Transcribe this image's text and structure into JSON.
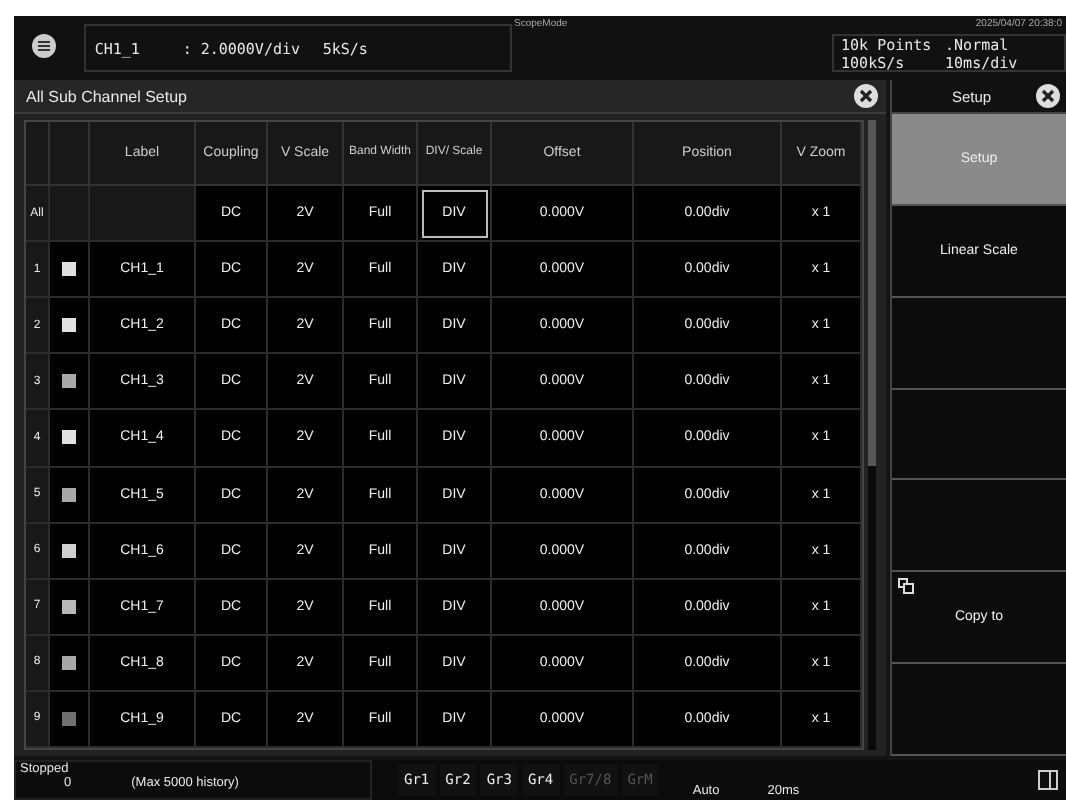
{
  "header": {
    "mode_title": "ScopeMode",
    "datetime": "2025/04/07 20:38:0",
    "channel_info": {
      "channel": "CH1_1",
      "scale": ": 2.0000V/div",
      "rate": "5kS/s"
    },
    "acquisition": {
      "points": "10k Points",
      "mode": ".Normal",
      "sample_rate": "100kS/s",
      "time_div": "10ms/div"
    }
  },
  "dialog": {
    "title": "All Sub Channel Setup",
    "columns": [
      "",
      "",
      "Label",
      "Coupling",
      "V Scale",
      "Band Width",
      "DIV/ Scale",
      "Offset",
      "Position",
      "V Zoom"
    ],
    "all_row": {
      "index": "All",
      "cells": [
        {
          "text": "DC",
          "selected": false
        },
        {
          "text": "2V",
          "selected": false
        },
        {
          "text": "Full",
          "selected": false
        },
        {
          "text": "DIV",
          "selected": true
        },
        {
          "text": "0.000V",
          "selected": false
        },
        {
          "text": "0.00div",
          "selected": false
        },
        {
          "text": "x 1",
          "selected": false
        }
      ]
    },
    "rows": [
      {
        "index": "1",
        "color": "#e0e0e0",
        "label": "CH1_1",
        "coupling": "DC",
        "v_scale": "2V",
        "band_width": "Full",
        "div_scale": "DIV",
        "offset": "0.000V",
        "position": "0.00div",
        "v_zoom": "x 1"
      },
      {
        "index": "2",
        "color": "#e0e0e0",
        "label": "CH1_2",
        "coupling": "DC",
        "v_scale": "2V",
        "band_width": "Full",
        "div_scale": "DIV",
        "offset": "0.000V",
        "position": "0.00div",
        "v_zoom": "x 1"
      },
      {
        "index": "3",
        "color": "#a8a8a8",
        "label": "CH1_3",
        "coupling": "DC",
        "v_scale": "2V",
        "band_width": "Full",
        "div_scale": "DIV",
        "offset": "0.000V",
        "position": "0.00div",
        "v_zoom": "x 1"
      },
      {
        "index": "4",
        "color": "#e0e0e0",
        "label": "CH1_4",
        "coupling": "DC",
        "v_scale": "2V",
        "band_width": "Full",
        "div_scale": "DIV",
        "offset": "0.000V",
        "position": "0.00div",
        "v_zoom": "x 1"
      },
      {
        "index": "5",
        "color": "#a8a8a8",
        "label": "CH1_5",
        "coupling": "DC",
        "v_scale": "2V",
        "band_width": "Full",
        "div_scale": "DIV",
        "offset": "0.000V",
        "position": "0.00div",
        "v_zoom": "x 1"
      },
      {
        "index": "6",
        "color": "#d0d0d0",
        "label": "CH1_6",
        "coupling": "DC",
        "v_scale": "2V",
        "band_width": "Full",
        "div_scale": "DIV",
        "offset": "0.000V",
        "position": "0.00div",
        "v_zoom": "x 1"
      },
      {
        "index": "7",
        "color": "#b8b8b8",
        "label": "CH1_7",
        "coupling": "DC",
        "v_scale": "2V",
        "band_width": "Full",
        "div_scale": "DIV",
        "offset": "0.000V",
        "position": "0.00div",
        "v_zoom": "x 1"
      },
      {
        "index": "8",
        "color": "#a8a8a8",
        "label": "CH1_8",
        "coupling": "DC",
        "v_scale": "2V",
        "band_width": "Full",
        "div_scale": "DIV",
        "offset": "0.000V",
        "position": "0.00div",
        "v_zoom": "x 1"
      },
      {
        "index": "9",
        "color": "#707070",
        "label": "CH1_9",
        "coupling": "DC",
        "v_scale": "2V",
        "band_width": "Full",
        "div_scale": "DIV",
        "offset": "0.000V",
        "position": "0.00div",
        "v_zoom": "x 1"
      }
    ]
  },
  "side_panel": {
    "title": "Setup",
    "items": [
      {
        "kind": "button",
        "label": "Setup",
        "selected": true
      },
      {
        "kind": "button",
        "label": "Linear Scale",
        "selected": false
      },
      {
        "kind": "blank"
      },
      {
        "kind": "blank"
      },
      {
        "kind": "blank"
      },
      {
        "kind": "copy",
        "label": "Copy to",
        "selected": false
      },
      {
        "kind": "blank"
      }
    ]
  },
  "status_bar": {
    "state": "Stopped",
    "count": "0",
    "history": "(Max 5000 history)",
    "groups": [
      {
        "label": "Gr1",
        "disabled": false
      },
      {
        "label": "Gr2",
        "disabled": false
      },
      {
        "label": "Gr3",
        "disabled": false
      },
      {
        "label": "Gr4",
        "disabled": false
      },
      {
        "label": "Gr7/8",
        "disabled": true
      },
      {
        "label": "GrM",
        "disabled": true
      }
    ],
    "trigger_mode": "Auto",
    "trigger_value": "20ms"
  }
}
